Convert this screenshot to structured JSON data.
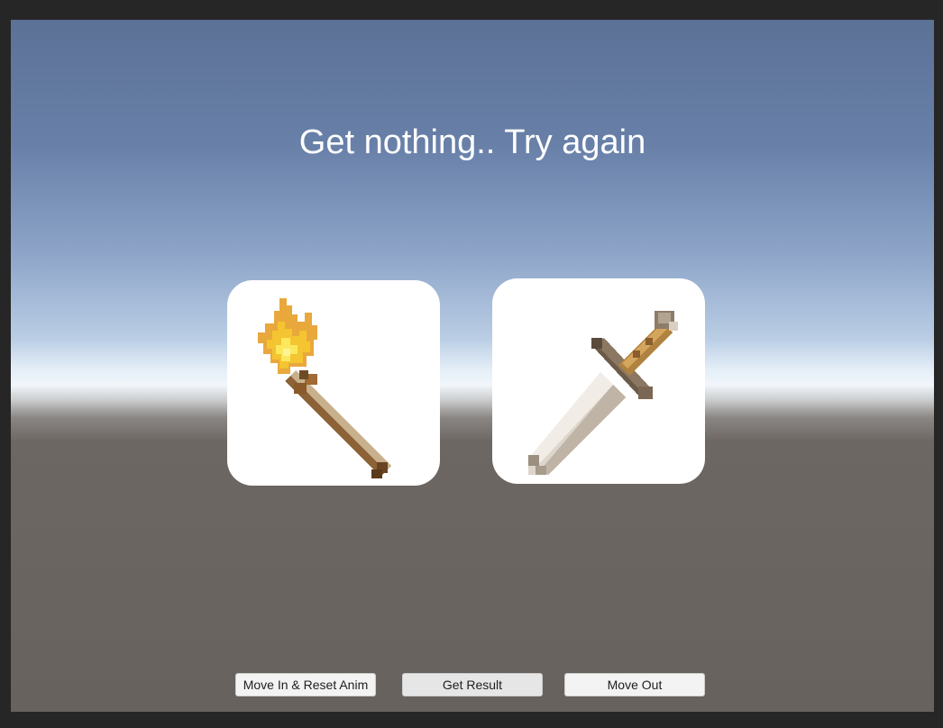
{
  "scene": {
    "message": "Get nothing.. Try again"
  },
  "cards": [
    {
      "item": "torch",
      "icon": "torch-icon"
    },
    {
      "item": "sword",
      "icon": "sword-icon"
    }
  ],
  "buttons": {
    "move_in_label": "Move In & Reset Anim",
    "get_result_label": "Get Result",
    "move_out_label": "Move Out"
  },
  "colors": {
    "sky_top": "#5c7196",
    "horizon": "#f1f6fb",
    "ground": "#67625e",
    "card_bg": "#ffffff",
    "button_bg": "#f3f3f3"
  }
}
